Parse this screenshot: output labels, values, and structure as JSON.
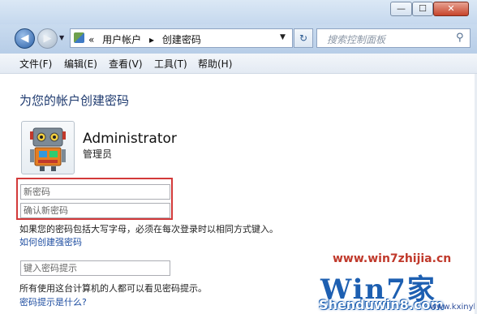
{
  "window": {
    "controls": {
      "minimize": "—",
      "maximize": "☐",
      "close": "✕"
    }
  },
  "navigation": {
    "back_glyph": "◀",
    "forward_glyph": "▶",
    "recent_glyph": "▼",
    "address": {
      "separator": "«",
      "path": [
        "用户帐户",
        "创建密码"
      ],
      "path_separator": "▸",
      "dropdown_glyph": "▼"
    },
    "refresh_glyph": "↻",
    "search": {
      "placeholder": "搜索控制面板",
      "icon": "search-icon",
      "icon_glyph": "⚲"
    }
  },
  "menu": {
    "items": [
      "文件(F)",
      "编辑(E)",
      "查看(V)",
      "工具(T)",
      "帮助(H)"
    ]
  },
  "page": {
    "title": "为您的帐户创建密码",
    "user": {
      "name": "Administrator",
      "role": "管理员"
    },
    "new_password_placeholder": "新密码",
    "confirm_password_placeholder": "确认新密码",
    "caps_note": "如果您的密码包括大写字母，必须在每次登录时以相同方式键入。",
    "strong_password_link": "如何创建强密码",
    "hint_placeholder": "键入密码提示",
    "hint_note": "所有使用这台计算机的人都可以看见密码提示。",
    "hint_link": "密码提示是什么?"
  },
  "watermark": {
    "url": "www.win7zhijia.cn",
    "logo": "Win7家",
    "brand": "Shenduwin8.com",
    "site": "www.kxinyk.com"
  },
  "colors": {
    "highlight": "#d33a3a",
    "link": "#1f4ea1",
    "title": "#1e3a6f"
  }
}
